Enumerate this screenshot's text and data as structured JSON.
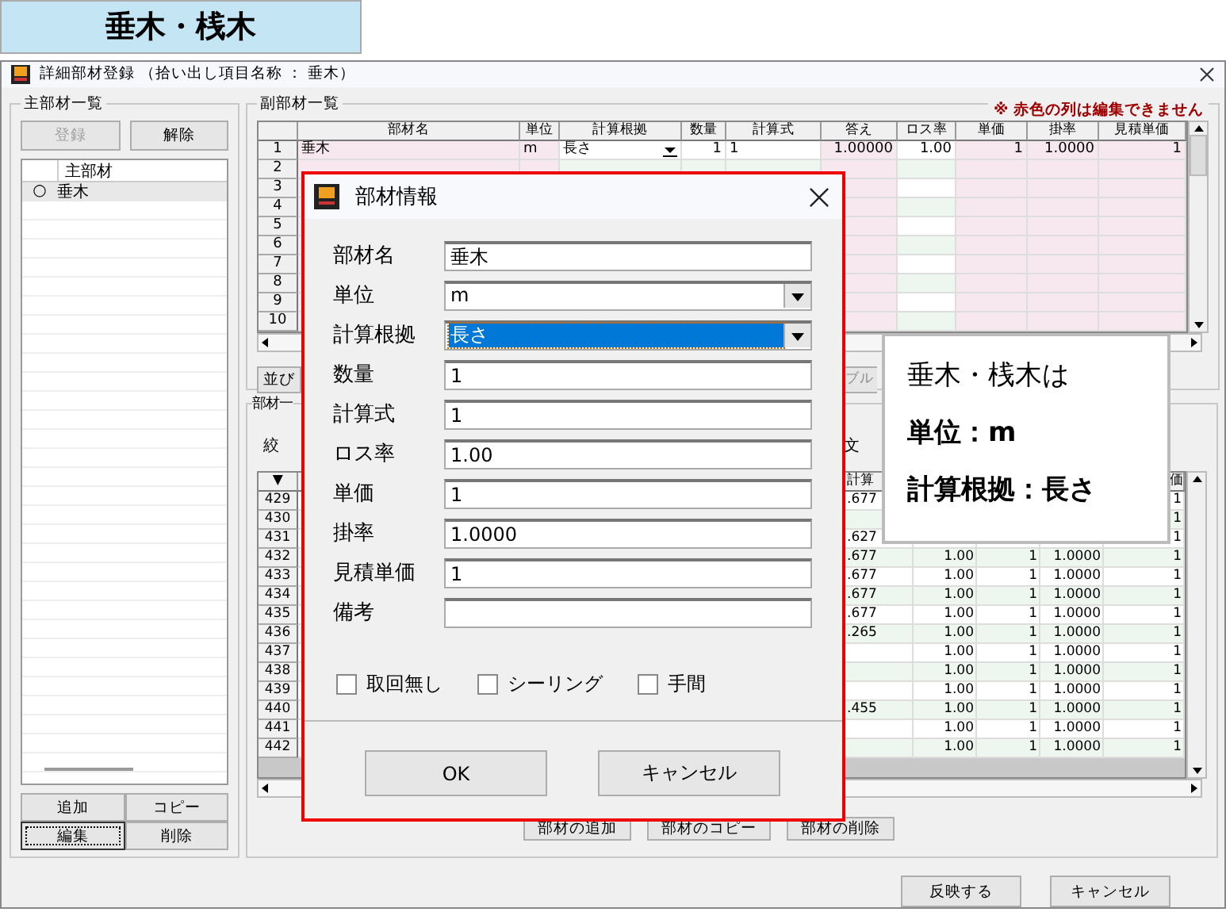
{
  "banner": {
    "title": "垂木・桟木"
  },
  "window": {
    "title": "詳細部材登録 （拾い出し項目名称 ： 垂木）"
  },
  "main_list": {
    "title": "主部材一覧",
    "top_buttons": [
      {
        "label": "登録",
        "disabled": true
      },
      {
        "label": "解除",
        "disabled": false
      }
    ],
    "header": "主部材",
    "rows": [
      {
        "marker": "○",
        "name": "垂木",
        "selected": true
      }
    ],
    "bottom_buttons": [
      {
        "label": "追加",
        "focused": false
      },
      {
        "label": "コピー",
        "focused": false
      },
      {
        "label": "編集",
        "focused": true
      },
      {
        "label": "削除",
        "focused": false
      }
    ]
  },
  "sub_list": {
    "title": "副部材一覧",
    "note": "※ 赤色の列は編集できません",
    "columns": [
      {
        "label": "部材名",
        "readonly": true
      },
      {
        "label": "単位",
        "readonly": true
      },
      {
        "label": "計算根拠",
        "readonly": false
      },
      {
        "label": "数量",
        "readonly": false
      },
      {
        "label": "計算式",
        "readonly": false
      },
      {
        "label": "答え",
        "readonly": true
      },
      {
        "label": "ロス率",
        "readonly": false
      },
      {
        "label": "単価",
        "readonly": true
      },
      {
        "label": "掛率",
        "readonly": true
      },
      {
        "label": "見積単価",
        "readonly": true
      }
    ],
    "rows": [
      {
        "number": "1",
        "cells": [
          "垂木",
          "m",
          "長さ",
          "1",
          "1",
          "1.00000",
          "1.00",
          "1",
          "1.0000",
          "1"
        ]
      },
      {
        "number": "2"
      },
      {
        "number": "3"
      },
      {
        "number": "4"
      },
      {
        "number": "5"
      },
      {
        "number": "6"
      },
      {
        "number": "7"
      },
      {
        "number": "8"
      },
      {
        "number": "9"
      },
      {
        "number": "10"
      }
    ],
    "buttons": [
      {
        "label": "並び",
        "disabled": false
      },
      {
        "label": "ブル",
        "disabled": true
      }
    ]
  },
  "parts_list": {
    "title": "部材一",
    "filter_label": "絞",
    "text_label": "文",
    "sort_marker": "▼",
    "calc_header": "計算",
    "price_header": "価",
    "rows": [
      {
        "number": "429",
        "calc": ".677",
        "price": "1"
      },
      {
        "number": "430",
        "price": "1"
      },
      {
        "number": "431",
        "calc": ".627",
        "price": "1"
      },
      {
        "number": "432",
        "calc": ".677",
        "loss": "1.00",
        "unit": "1",
        "rate": "1.0000",
        "price": "1"
      },
      {
        "number": "433",
        "calc": ".677",
        "loss": "1.00",
        "unit": "1",
        "rate": "1.0000",
        "price": "1"
      },
      {
        "number": "434",
        "calc": ".677",
        "loss": "1.00",
        "unit": "1",
        "rate": "1.0000",
        "price": "1"
      },
      {
        "number": "435",
        "calc": ".677",
        "loss": "1.00",
        "unit": "1",
        "rate": "1.0000",
        "price": "1"
      },
      {
        "number": "436",
        "calc": ".265",
        "loss": "1.00",
        "unit": "1",
        "rate": "1.0000",
        "price": "1"
      },
      {
        "number": "437",
        "loss": "1.00",
        "unit": "1",
        "rate": "1.0000",
        "price": "1"
      },
      {
        "number": "438",
        "loss": "1.00",
        "unit": "1",
        "rate": "1.0000",
        "price": "1"
      },
      {
        "number": "439",
        "loss": "1.00",
        "unit": "1",
        "rate": "1.0000",
        "price": "1"
      },
      {
        "number": "440",
        "calc": ".455",
        "loss": "1.00",
        "unit": "1",
        "rate": "1.0000",
        "price": "1"
      },
      {
        "number": "441",
        "loss": "1.00",
        "unit": "1",
        "rate": "1.0000",
        "price": "1"
      },
      {
        "number": "442",
        "loss": "1.00",
        "unit": "1",
        "rate": "1.0000",
        "price": "1"
      }
    ],
    "buttons": [
      "部材の追加",
      "部材のコピー",
      "部材の削除"
    ]
  },
  "actions": [
    "反映する",
    "キャンセル"
  ],
  "dialog": {
    "title": "部材情報",
    "fields": [
      {
        "label": "部材名",
        "kind": "text",
        "value": "垂木",
        "highlighted": false
      },
      {
        "label": "単位",
        "kind": "select",
        "value": "m",
        "highlighted": false
      },
      {
        "label": "計算根拠",
        "kind": "select",
        "value": "長さ",
        "highlighted": true
      },
      {
        "label": "数量",
        "kind": "text",
        "value": "1",
        "highlighted": false
      },
      {
        "label": "計算式",
        "kind": "text",
        "value": "1",
        "highlighted": false
      },
      {
        "label": "ロス率",
        "kind": "text",
        "value": "1.00",
        "highlighted": false
      },
      {
        "label": "単価",
        "kind": "text",
        "value": "1",
        "highlighted": false
      },
      {
        "label": "掛率",
        "kind": "text",
        "value": "1.0000",
        "highlighted": false
      },
      {
        "label": "見積単価",
        "kind": "text",
        "value": "1",
        "highlighted": false
      },
      {
        "label": "備考",
        "kind": "text",
        "highlighted": false
      }
    ],
    "checkboxes": [
      {
        "label": "取回無し",
        "checked": false
      },
      {
        "label": "シーリング",
        "checked": false
      },
      {
        "label": "手間",
        "checked": false
      }
    ],
    "buttons": [
      "OK",
      "キャンセル"
    ]
  },
  "callout": {
    "lines": [
      {
        "text": "垂木・桟木は",
        "bold": false
      },
      {
        "text": "単位：m",
        "bold": true
      },
      {
        "text": "計算根拠：長さ",
        "bold": true
      }
    ]
  }
}
